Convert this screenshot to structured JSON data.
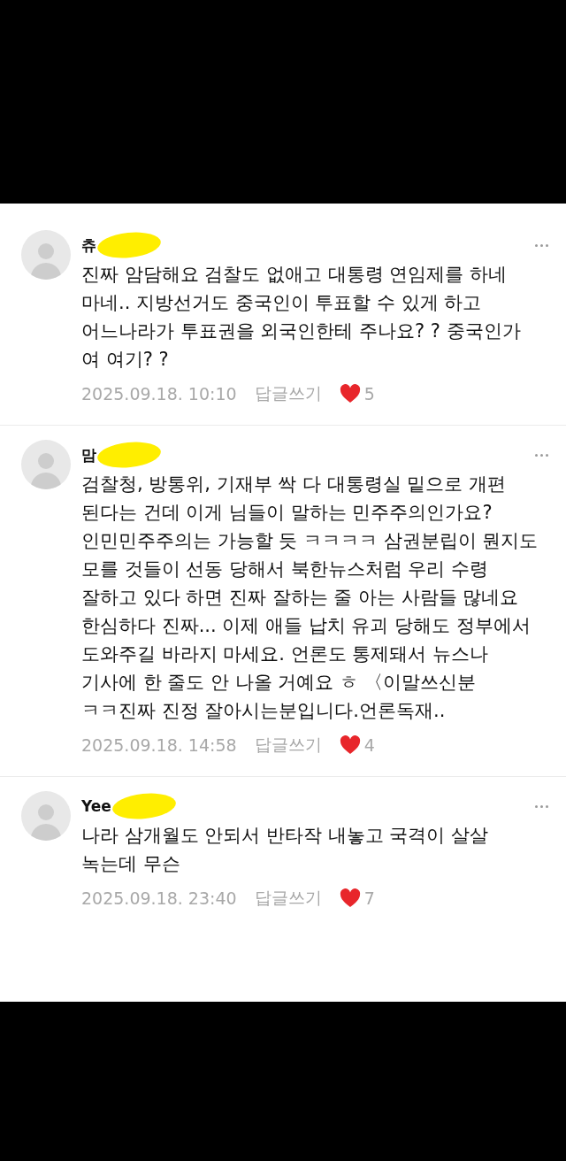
{
  "comments": [
    {
      "name": "츄",
      "body": "진짜 암담해요 검찰도 없애고 대통령 연임제를 하네 마네.. 지방선거도 중국인이 투표할 수 있게 하고 어느나라가 투표권을 외국인한테 주나요? ?  중국인가 여 여기? ?",
      "date": "2025.09.18. 10:10",
      "reply": "답글쓰기",
      "likes": "5"
    },
    {
      "name": "맘",
      "body": "검찰청, 방통위, 기재부 싹 다 대통령실 밑으로 개편 된다는 건데 이게 님들이 말하는 민주주의인가요? 인민민주주의는 가능할 듯 ㅋㅋㅋㅋ 삼권분립이 뭔지도 모를 것들이 선동 당해서 북한뉴스처럼 우리 수령 잘하고 있다 하면 진짜 잘하는 줄 아는 사람들 많네요 한심하다 진짜... 이제 애들 납치 유괴 당해도 정부에서 도와주길 바라지 마세요. 언론도 통제돼서 뉴스나 기사에 한 줄도 안 나올 거예요 ㅎ 〈이말쓰신분 ㅋㅋ진짜 진정 잘아시는분입니다.언론독재..",
      "date": "2025.09.18. 14:58",
      "reply": "답글쓰기",
      "likes": "4"
    },
    {
      "name": "Yee",
      "body": "나라 삼개월도 안되서 반타작 내놓고 국격이 살살 녹는데 무슨",
      "date": "2025.09.18. 23:40",
      "reply": "답글쓰기",
      "likes": "7"
    }
  ]
}
